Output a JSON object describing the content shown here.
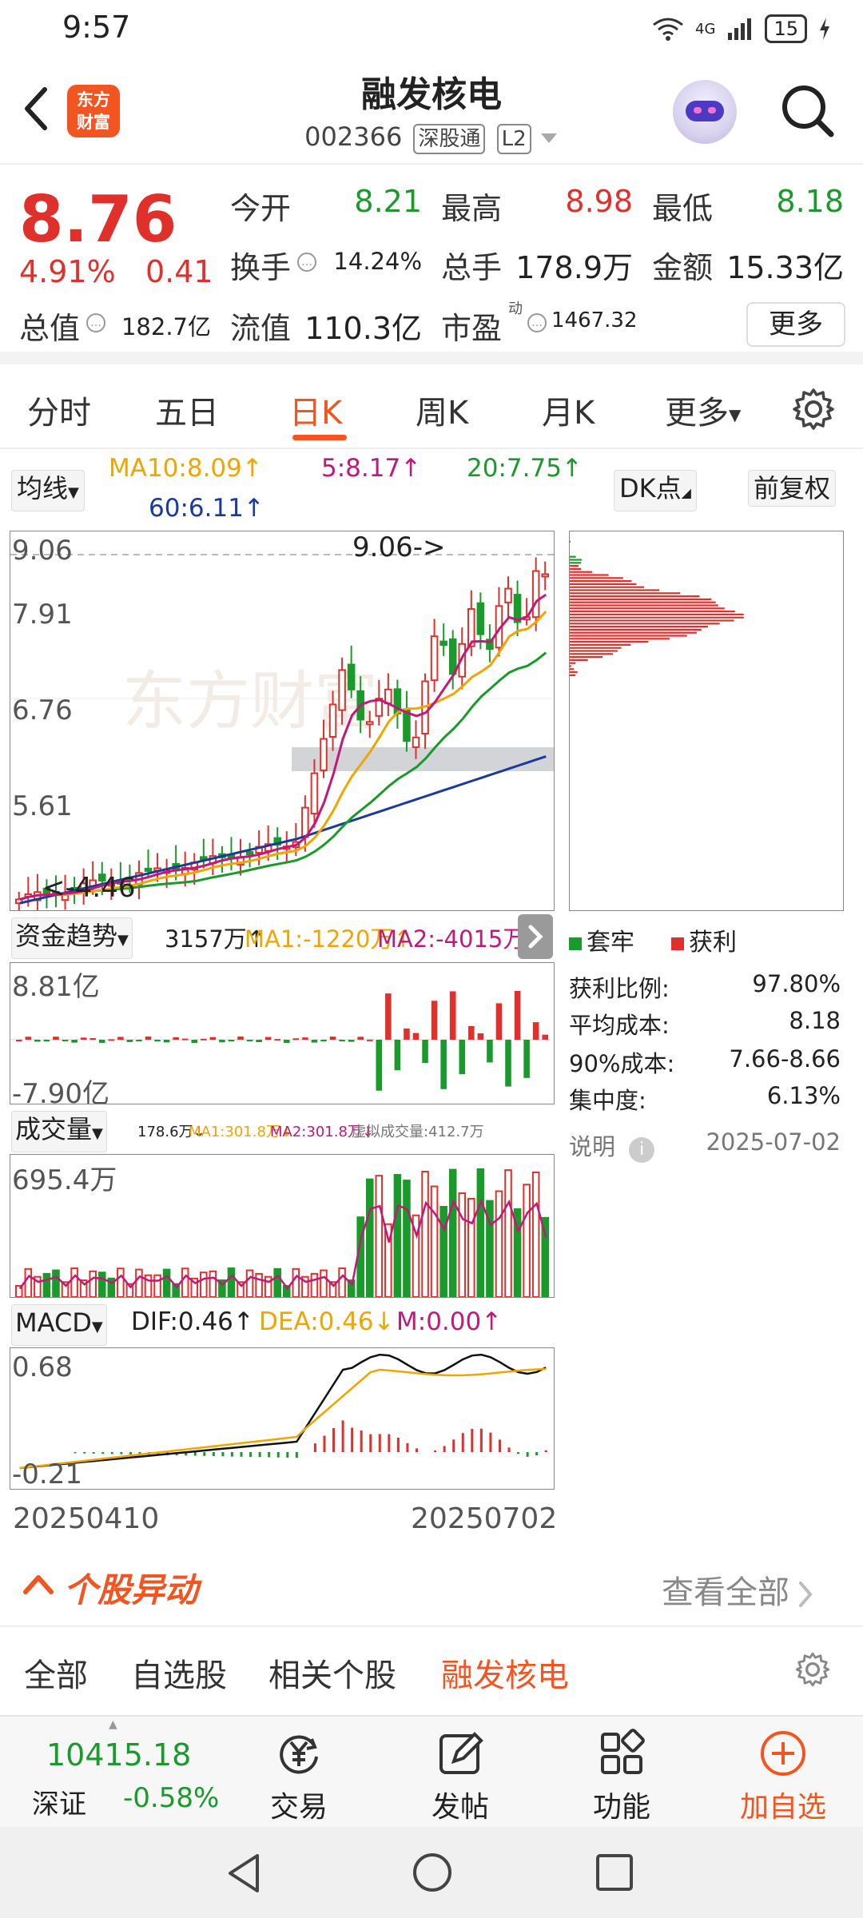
{
  "status_bar": {
    "time": "9:57",
    "signal": "4G",
    "battery": "15"
  },
  "header": {
    "stock_name": "融发核电",
    "stock_code": "002366",
    "tag_connect": "深股通",
    "tag_level": "L2",
    "logo_line1": "东方",
    "logo_line2": "财富"
  },
  "quote": {
    "price": "8.76",
    "change_pct": "4.91%",
    "change_val": "0.41",
    "open_label": "今开",
    "open": "8.21",
    "high_label": "最高",
    "high": "8.98",
    "low_label": "最低",
    "low": "8.18",
    "turnover_label": "换手",
    "turnover": "14.24%",
    "volume_label": "总手",
    "volume": "178.9万",
    "amount_label": "金额",
    "amount": "15.33亿",
    "total_cap_label": "总值",
    "total_cap": "182.7亿",
    "float_cap_label": "流值",
    "float_cap": "110.3亿",
    "pe_label": "市盈",
    "pe_sup": "动",
    "pe": "1467.32",
    "more": "更多"
  },
  "tabs": [
    "分时",
    "五日",
    "日K",
    "周K",
    "月K",
    "更多"
  ],
  "chart": {
    "ma_select": "均线",
    "ma10": "MA10:8.09↑",
    "ma5": "5:8.17↑",
    "ma20": "20:7.75↑",
    "ma60": "60:6.11↑",
    "dk_button": "DK点",
    "fq_button": "前复权",
    "max_marker": "9.06->",
    "min_marker": "<-4.46",
    "price_axis": [
      "9.06",
      "7.91",
      "6.76",
      "5.61"
    ],
    "fund_select": "资金趋势",
    "fund_val": "3157万↑",
    "fund_ma1": "MA1:-1220万↑",
    "fund_ma2": "MA2:-4015万↑",
    "fund_axis_top": "8.81亿",
    "fund_axis_bottom": "-7.90亿",
    "vol_select": "成交量",
    "vol_val": "178.6万↓",
    "vol_ma1": "MA1:301.8万↓",
    "vol_ma2": "MA2:301.8万↓",
    "vol_virtual": "虚拟成交量:412.7万",
    "vol_axis_top": "695.4万",
    "macd_select": "MACD",
    "dif": "DIF:0.46↑",
    "dea": "DEA:0.46↓",
    "m": "M:0.00↑",
    "macd_axis_top": "0.68",
    "macd_axis_bottom": "-0.21",
    "date_start": "20250410",
    "date_end": "20250702",
    "colors": {
      "up": "#e0302b",
      "down": "#1a9a2a",
      "ma10": "#f0a500",
      "ma5": "#c2187a",
      "ma20": "#1a9a2a",
      "ma60": "#1c3a9c"
    }
  },
  "distribution": {
    "legend_trapped": "套牢",
    "legend_profit": "获利",
    "stats": [
      {
        "label": "获利比例:",
        "value": "97.80%"
      },
      {
        "label": "平均成本:",
        "value": "8.18"
      },
      {
        "label": "90%成本:",
        "value": "7.66-8.66"
      },
      {
        "label": "集中度:",
        "value": "6.13%"
      }
    ],
    "note_label": "说明",
    "date": "2025-07-02"
  },
  "anomaly": {
    "title": "个股异动",
    "view_all": "查看全部"
  },
  "subtabs": [
    "全部",
    "自选股",
    "相关个股",
    "融发核电"
  ],
  "bottom_bar": {
    "index_value": "10415.18",
    "index_name": "深证",
    "index_change": "-0.58%",
    "items": [
      "交易",
      "发帖",
      "功能",
      "加自选"
    ]
  }
}
